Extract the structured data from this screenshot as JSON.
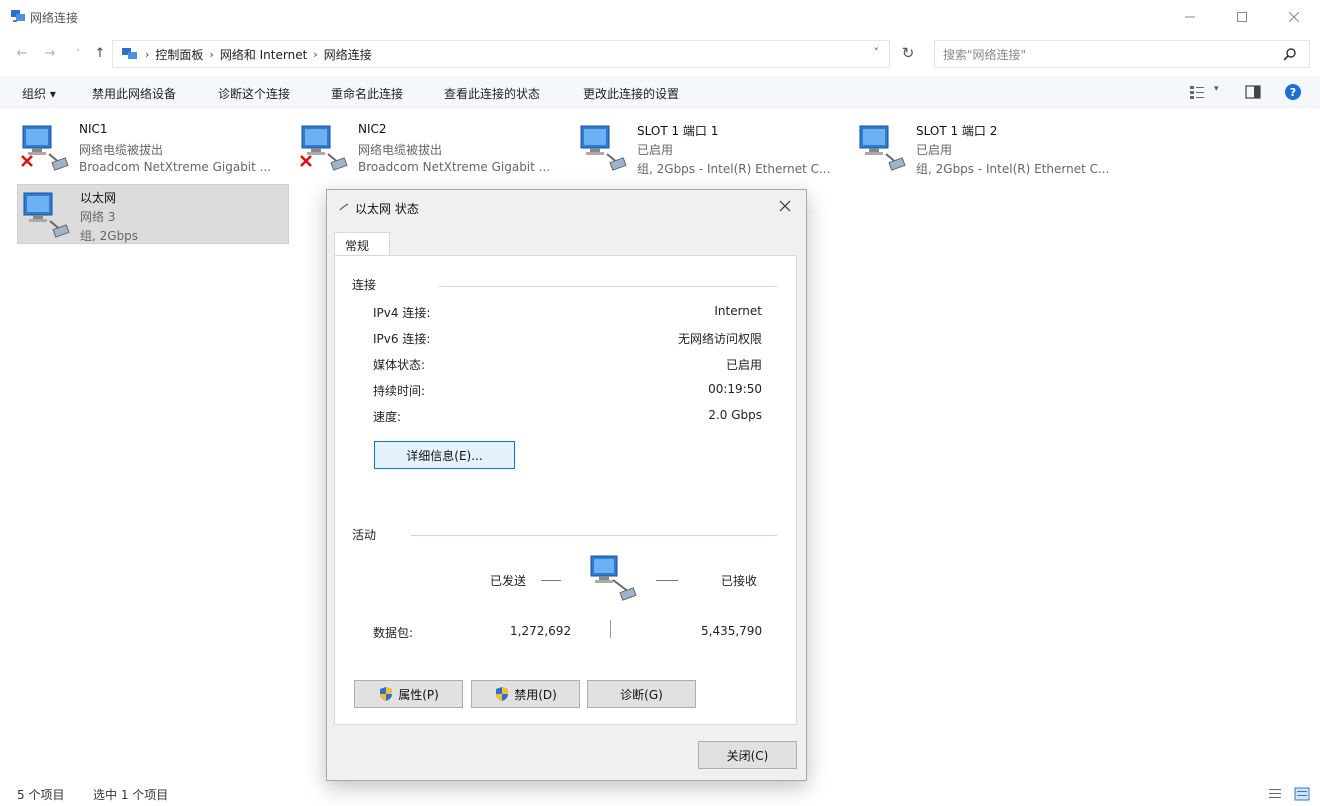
{
  "window": {
    "title": "网络连接"
  },
  "address": {
    "crumbs": [
      "控制面板",
      "网络和 Internet",
      "网络连接"
    ],
    "search_placeholder": "搜索\"网络连接\""
  },
  "commands": [
    "组织 ▾",
    "禁用此网络设备",
    "诊断这个连接",
    "重命名此连接",
    "查看此连接的状态",
    "更改此连接的设置"
  ],
  "adapters": [
    {
      "name": "NIC1",
      "status": "网络电缆被拔出",
      "device": "Broadcom NetXtreme Gigabit ...",
      "disconnected": true
    },
    {
      "name": "NIC2",
      "status": "网络电缆被拔出",
      "device": "Broadcom NetXtreme Gigabit ...",
      "disconnected": true
    },
    {
      "name": "SLOT 1 端口 1",
      "status": "已启用",
      "device": "组, 2Gbps - Intel(R) Ethernet C...",
      "disconnected": false
    },
    {
      "name": "SLOT 1 端口 2",
      "status": "已启用",
      "device": "组, 2Gbps - Intel(R) Ethernet C...",
      "disconnected": false
    },
    {
      "name": "以太网",
      "status": "网络 3",
      "device": "组, 2Gbps",
      "disconnected": false,
      "selected": true
    }
  ],
  "statusbar": {
    "count": "5 个项目",
    "selected": "选中 1 个项目"
  },
  "dialog": {
    "title": "以太网 状态",
    "tab": "常规",
    "connection_label": "连接",
    "rows": [
      {
        "label": "IPv4 连接:",
        "value": "Internet"
      },
      {
        "label": "IPv6 连接:",
        "value": "无网络访问权限"
      },
      {
        "label": "媒体状态:",
        "value": "已启用"
      },
      {
        "label": "持续时间:",
        "value": "00:19:50"
      },
      {
        "label": "速度:",
        "value": "2.0 Gbps"
      }
    ],
    "details_button": "详细信息(E)...",
    "activity_label": "活动",
    "sent_label": "已发送",
    "received_label": "已接收",
    "packets_label": "数据包:",
    "packets_sent": "1,272,692",
    "packets_received": "5,435,790",
    "properties_button": "属性(P)",
    "disable_button": "禁用(D)",
    "diagnose_button": "诊断(G)",
    "close_button": "关闭(C)"
  }
}
